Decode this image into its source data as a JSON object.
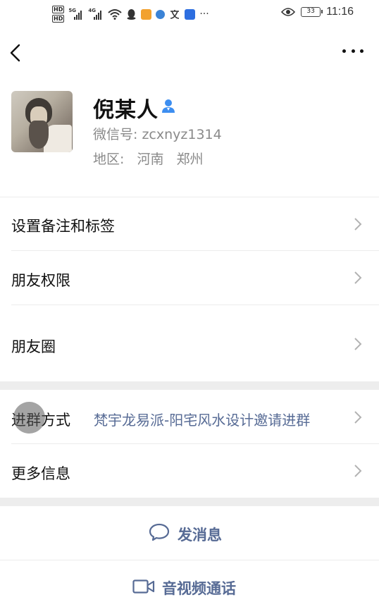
{
  "status_bar": {
    "hd1": "HD",
    "hd2": "HD",
    "net1": "5G",
    "net2": "4G",
    "more": "···",
    "battery": "33",
    "time": "11:16"
  },
  "profile": {
    "name": "倪某人",
    "wechat_id": "微信号: zcxnyz1314",
    "region_label": "地区:",
    "region_province": "河南",
    "region_city": "郑州"
  },
  "menu": {
    "remark_tags": "设置备注和标签",
    "friend_permissions": "朋友权限",
    "moments": "朋友圈",
    "join_group_label": "进群方式",
    "join_group_value": "梵宇龙易派-阳宅风水设计邀请进群",
    "more_info": "更多信息"
  },
  "actions": {
    "send_message": "发消息",
    "video_call": "音视频通话"
  },
  "icons": {
    "back": "back-arrow-icon",
    "more": "more-icon",
    "verify": "person-icon",
    "chat": "chat-bubble-icon",
    "video": "video-camera-icon"
  },
  "colors": {
    "link": "#576b95",
    "secondary_text": "#8a8a8a",
    "separator": "#ededed",
    "verify_blue": "#3d8ef0"
  }
}
